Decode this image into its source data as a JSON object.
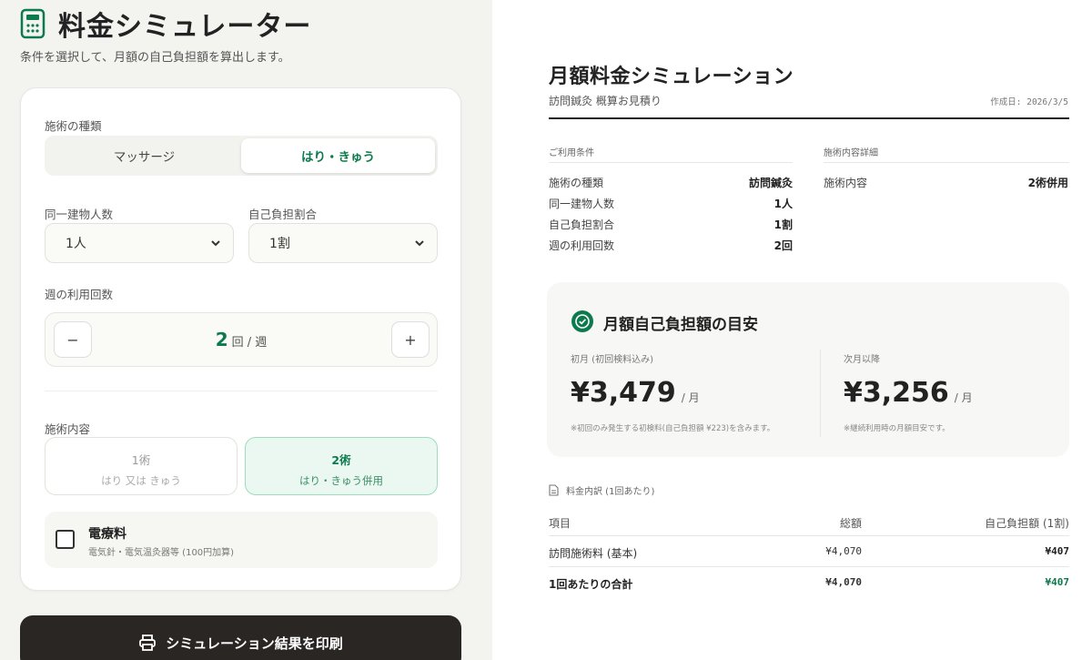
{
  "header": {
    "title": "料金シミュレーター",
    "subtitle": "条件を選択して、月額の自己負担額を算出します。"
  },
  "form": {
    "treatment_type": {
      "label": "施術の種類",
      "options": [
        "マッサージ",
        "はり・きゅう"
      ],
      "selected": "はり・きゅう"
    },
    "same_building": {
      "label": "同一建物人数",
      "value": "1人"
    },
    "copay_ratio": {
      "label": "自己負担割合",
      "value": "1割"
    },
    "weekly": {
      "label": "週の利用回数",
      "count": "2",
      "unit": "回 / 週",
      "minus": "−",
      "plus": "+"
    },
    "content": {
      "label": "施術内容",
      "options": [
        {
          "title": "1術",
          "sub": "はり 又は きゅう"
        },
        {
          "title": "2術",
          "sub": "はり・きゅう併用"
        }
      ],
      "selected": "2術"
    },
    "electro": {
      "title": "電療料",
      "sub": "電気針・電気温灸器等 (100円加算)",
      "checked": false
    }
  },
  "print_button": {
    "label": "シミュレーション結果を印刷"
  },
  "doc": {
    "title": "月額料金シミュレーション",
    "subtitle": "訪問鍼灸 概算お見積り",
    "date": "作成日: 2026/3/5",
    "conditions": {
      "heading": "ご利用条件",
      "rows": [
        {
          "k": "施術の種類",
          "v": "訪問鍼灸"
        },
        {
          "k": "同一建物人数",
          "v": "1人"
        },
        {
          "k": "自己負担割合",
          "v": "1割"
        },
        {
          "k": "週の利用回数",
          "v": "2回"
        }
      ]
    },
    "details": {
      "heading": "施術内容詳細",
      "rows": [
        {
          "k": "施術内容",
          "v": "2術併用"
        }
      ]
    },
    "summary": {
      "title": "月額自己負担額の目安",
      "first": {
        "label": "初月 (初回検料込み)",
        "value": "¥3,479",
        "unit": "/ 月",
        "note": "※初回のみ発生する初検料(自己負担額 ¥223)を含みます。"
      },
      "next": {
        "label": "次月以降",
        "value": "¥3,256",
        "unit": "/ 月",
        "note": "※継続利用時の月額目安です。"
      }
    },
    "breakdown": {
      "heading": "料金内訳 (1回あたり)",
      "columns": [
        "項目",
        "総額",
        "自己負担額 (1割)"
      ],
      "rows": [
        {
          "item": "訪問施術料 (基本)",
          "total": "¥4,070",
          "copay": "¥407"
        },
        {
          "item": "1回あたりの合計",
          "total": "¥4,070",
          "copay": "¥407"
        }
      ]
    },
    "colors": {
      "accent": "#0d7a4e",
      "accent_soft": "#eaf8f1"
    }
  }
}
